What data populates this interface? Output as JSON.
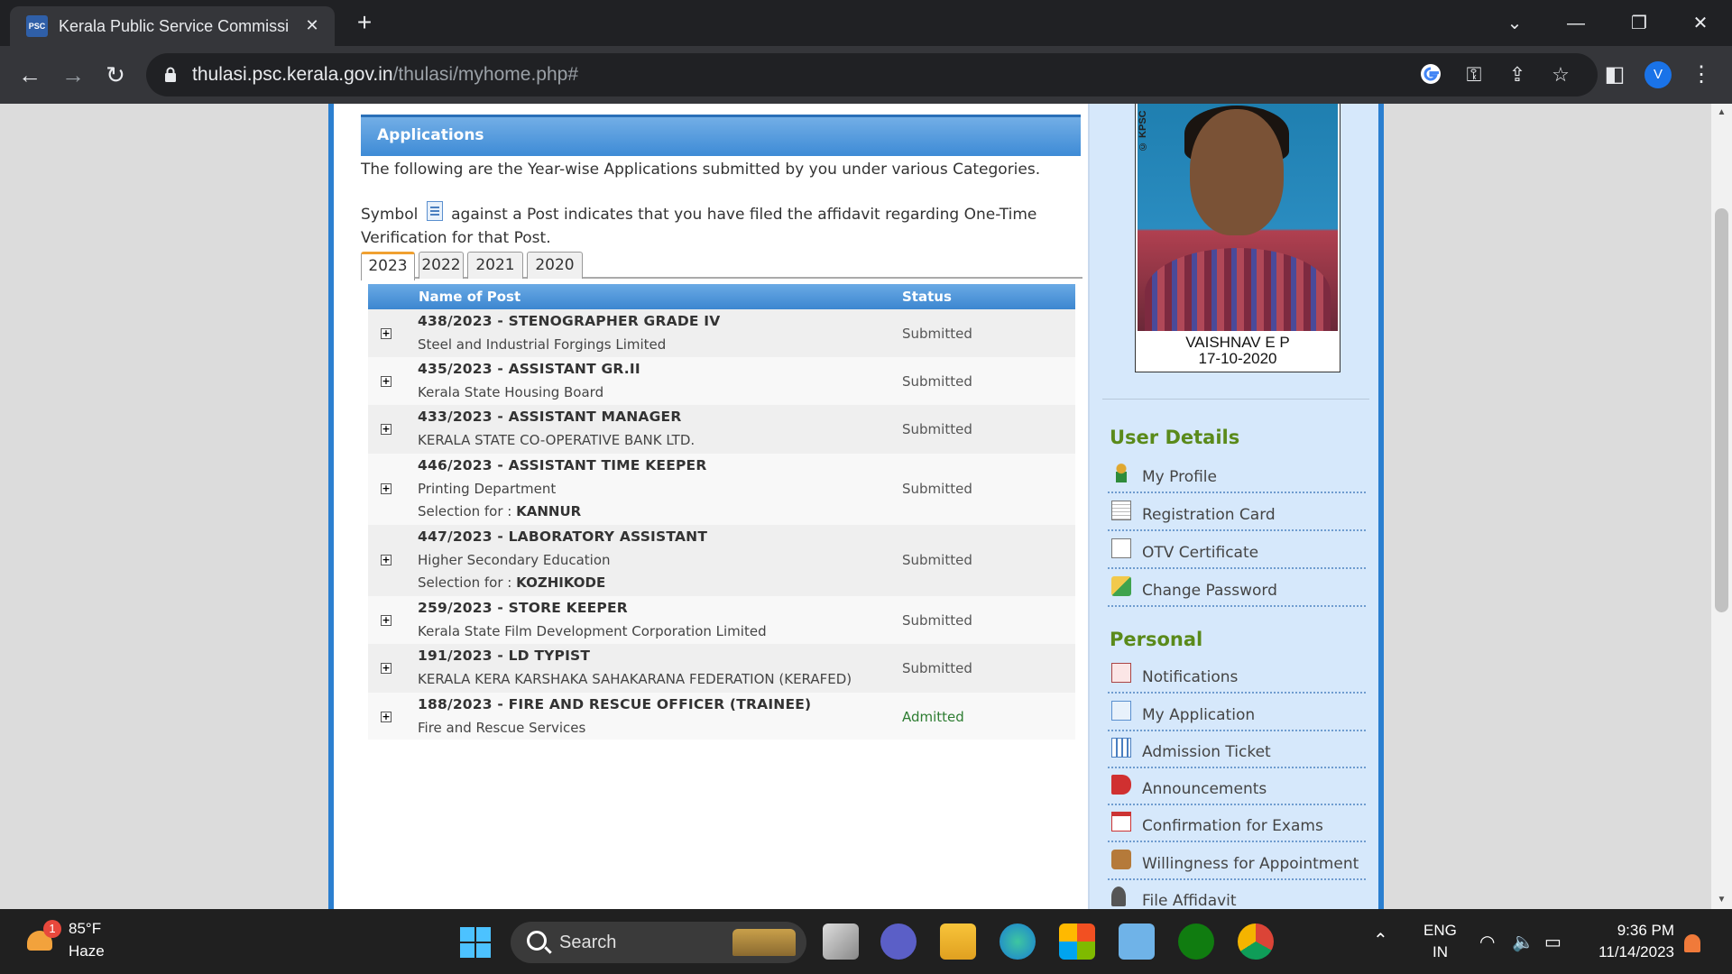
{
  "browser": {
    "tab_title": "Kerala Public Service Commission",
    "url_host": "thulasi.psc.kerala.gov.in",
    "url_path": "/thulasi/myhome.php#",
    "profile_initial": "V"
  },
  "applications": {
    "header": "Applications",
    "intro": "The following are the Year-wise Applications submitted by you under various Categories.",
    "symbol_prefix": "Symbol",
    "symbol_text": "against a Post indicates that you have filed the affidavit regarding One-Time Verification for that Post.",
    "year_tabs": [
      "2023",
      "2022",
      "2021",
      "2020"
    ],
    "active_year": "2023",
    "col_name": "Name of Post",
    "col_status": "Status",
    "selection_label": "Selection for :",
    "rows": [
      {
        "post": "438/2023 - STENOGRAPHER GRADE IV",
        "dept": "Steel and Industrial Forgings Limited",
        "selection": "",
        "status": "Submitted"
      },
      {
        "post": "435/2023 - ASSISTANT GR.II",
        "dept": "Kerala State Housing Board",
        "selection": "",
        "status": "Submitted"
      },
      {
        "post": "433/2023 - ASSISTANT MANAGER",
        "dept": "KERALA STATE CO-OPERATIVE BANK LTD.",
        "selection": "",
        "status": "Submitted"
      },
      {
        "post": "446/2023 - ASSISTANT TIME KEEPER",
        "dept": "Printing Department",
        "selection": "KANNUR",
        "status": "Submitted"
      },
      {
        "post": "447/2023 - LABORATORY ASSISTANT",
        "dept": "Higher Secondary Education",
        "selection": "KOZHIKODE",
        "status": "Submitted"
      },
      {
        "post": "259/2023 - STORE KEEPER",
        "dept": "Kerala State Film Development Corporation Limited",
        "selection": "",
        "status": "Submitted"
      },
      {
        "post": "191/2023 - LD TYPIST",
        "dept": "KERALA KERA KARSHAKA SAHAKARANA FEDERATION (KERAFED)",
        "selection": "",
        "status": "Submitted"
      },
      {
        "post": "188/2023 - FIRE AND RESCUE OFFICER (TRAINEE)",
        "dept": "Fire and Rescue Services",
        "selection": "",
        "status": "Admitted"
      }
    ]
  },
  "profile": {
    "name": "VAISHNAV E P",
    "date": "17-10-2020",
    "photo_stamp": "© KPSC"
  },
  "sidebar": {
    "user_details_title": "User Details",
    "user_details": [
      "My Profile",
      "Registration Card",
      "OTV Certificate",
      "Change Password"
    ],
    "personal_title": "Personal",
    "personal": [
      "Notifications",
      "My Application",
      "Admission Ticket",
      "Announcements",
      "Confirmation for Exams",
      "Willingness for Appointment",
      "File Affidavit"
    ]
  },
  "taskbar": {
    "weather_badge": "1",
    "temperature": "85°F",
    "condition": "Haze",
    "search_label": "Search",
    "lang_top": "ENG",
    "lang_bottom": "IN",
    "time": "9:36 PM",
    "date": "11/14/2023"
  },
  "colors": {
    "accent_blue": "#2b7fd0",
    "section_green": "#5a8a1a",
    "admitted_green": "#2e7d32"
  }
}
